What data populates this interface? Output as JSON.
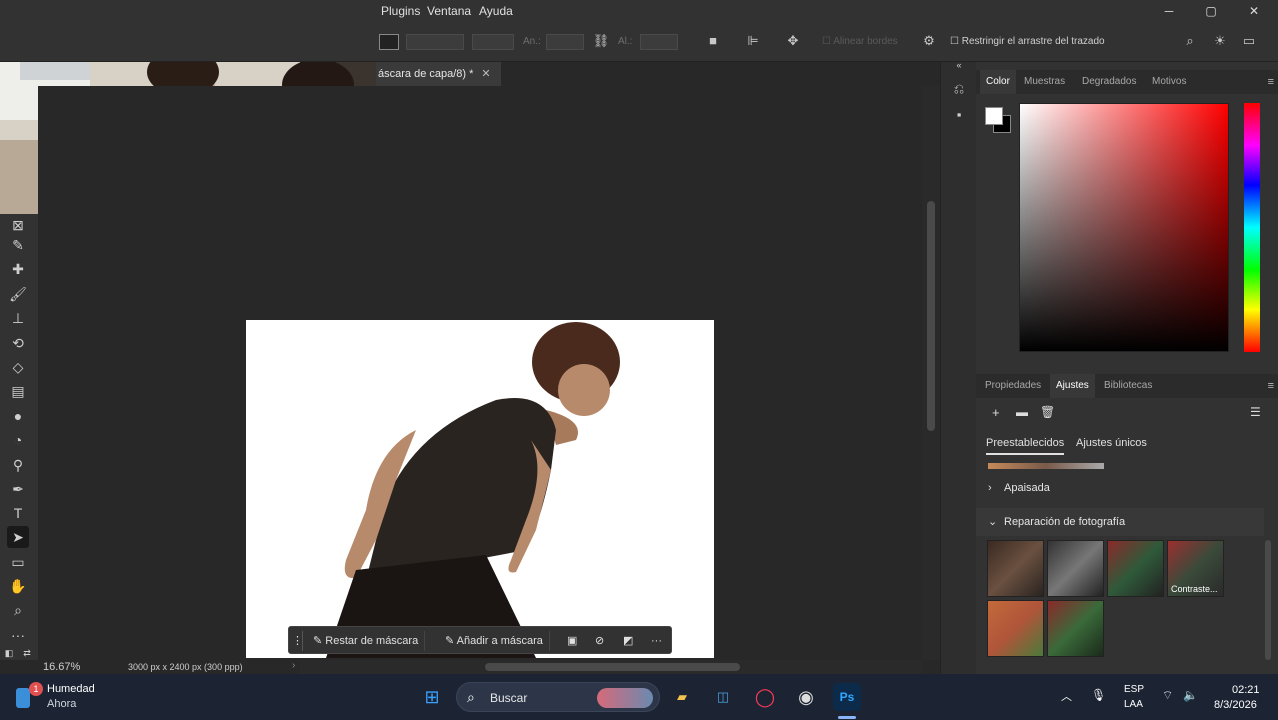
{
  "menu": {
    "items": [
      "Plugins",
      "Ventana",
      "Ayuda"
    ],
    "win_min": "─",
    "win_max": "▢",
    "win_close": "✕"
  },
  "options": {
    "an_label": "An.:",
    "al_label": "Al.:",
    "align_edges": "Alinear bordes",
    "restrict_label": "Restringir el arrastre del trazado"
  },
  "doc": {
    "tab_title": "áscara de capa/8) *",
    "tab_close": "✕"
  },
  "context_bar": {
    "subtract_mask": "Restar de máscara",
    "add_mask": "Añadir a máscara",
    "more": "···"
  },
  "status": {
    "zoom": "16.67%",
    "doc_info": "3000 px x 2400 px (300 ppp)"
  },
  "color_panel": {
    "tabs": [
      "Color",
      "Muestras",
      "Degradados",
      "Motivos"
    ],
    "active_tab": "Color",
    "foreground": "#ffffff",
    "background": "#000000"
  },
  "adjust_panel": {
    "tabs": [
      "Propiedades",
      "Ajustes",
      "Bibliotecas"
    ],
    "active_tab": "Ajustes",
    "subtabs": [
      "Preestablecidos",
      "Ajustes únicos"
    ],
    "sections": [
      "Apaisada",
      "Reparación de fotografía"
    ],
    "hover_label": "Contraste..."
  },
  "taskbar": {
    "weather_title": "Humedad",
    "weather_sub": "Ahora",
    "notification_count": "1",
    "search": "Buscar",
    "lang": "ESP",
    "lang_sub": "LAA",
    "time": "02:21",
    "date": "8/3/2026"
  }
}
